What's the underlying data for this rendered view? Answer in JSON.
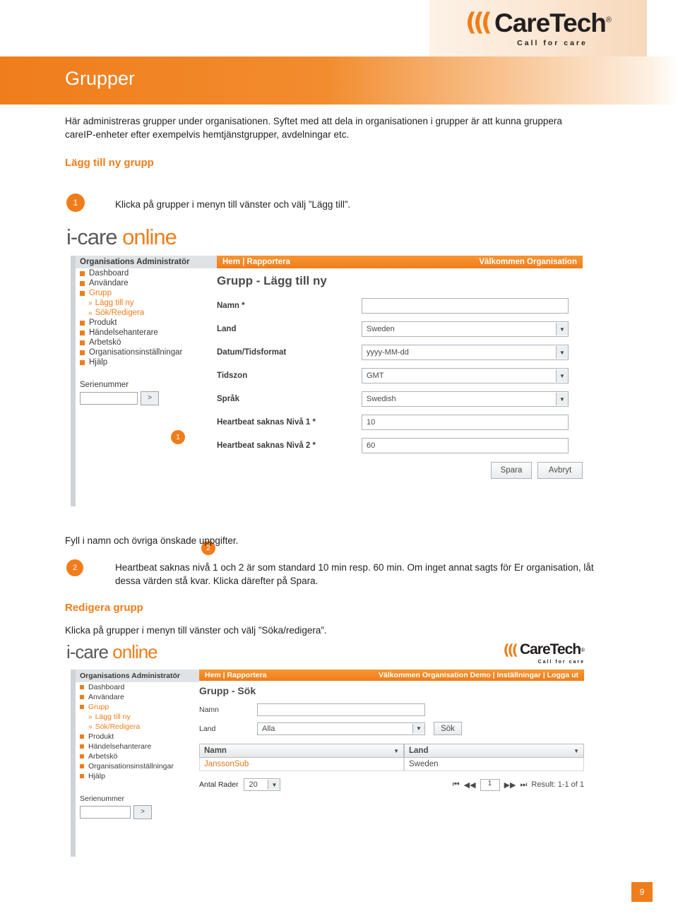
{
  "brand": {
    "chevrons": "(((",
    "name": "CareTech",
    "registered": "®",
    "tagline": "Call for care"
  },
  "page": {
    "title": "Grupper",
    "footer_page_number": "9"
  },
  "intro": "Här administreras grupper under organisationen. Syftet med att dela in organisationen i grupper är att kunna gruppera careIP-enheter efter exempelvis hemtjänstgrupper, avdelningar etc.",
  "sections": {
    "add_group_heading": "Lägg till ny grupp",
    "edit_group_heading": "Redigera grupp"
  },
  "steps": {
    "step1_number": "1",
    "step1_text": "Klicka på grupper i menyn till vänster och välj ”Lägg till”.",
    "after_shot1_text": "Fyll i namn och övriga önskade uppgifter.",
    "step2_number": "2",
    "step2_text": "Heartbeat saknas nivå 1 och 2 är som standard 10 min resp. 60 min. Om inget annat sagts för Er organisation, låt dessa värden stå kvar. Klicka därefter på Spara.",
    "edit_text": "Klicka på grupper i menyn till vänster och välj ”Söka/redigera”."
  },
  "screenshot1": {
    "logo_i": "i-care ",
    "logo_o": "online",
    "sidebar": {
      "header": "Organisations Administratör",
      "items": [
        {
          "label": "Dashboard",
          "type": "top"
        },
        {
          "label": "Användare",
          "type": "top"
        },
        {
          "label": "Grupp",
          "type": "top",
          "active": true
        },
        {
          "label": "Lägg till ny",
          "type": "sub"
        },
        {
          "label": "Sök/Redigera",
          "type": "sub"
        },
        {
          "label": "Produkt",
          "type": "top"
        },
        {
          "label": "Händelsehanterare",
          "type": "top"
        },
        {
          "label": "Arbetskö",
          "type": "top"
        },
        {
          "label": "Organisationsinställningar",
          "type": "top"
        },
        {
          "label": "Hjälp",
          "type": "top"
        }
      ],
      "serial_label": "Serienummer",
      "serial_value": "",
      "serial_button": ">"
    },
    "topnav_left": "Hem | Rapportera",
    "topnav_right": "Välkommen Organisation",
    "page_title": "Grupp - Lägg till ny",
    "form": [
      {
        "label": "Namn *",
        "value": "",
        "control": "input"
      },
      {
        "label": "Land",
        "value": "Sweden",
        "control": "select"
      },
      {
        "label": "Datum/Tidsformat",
        "value": "yyyy-MM-dd",
        "control": "select"
      },
      {
        "label": "Tidszon",
        "value": "GMT",
        "control": "select"
      },
      {
        "label": "Språk",
        "value": "Swedish",
        "control": "select"
      },
      {
        "label": "Heartbeat saknas Nivå 1 *",
        "value": "10",
        "control": "input"
      },
      {
        "label": "Heartbeat saknas Nivå 2 *",
        "value": "60",
        "control": "input"
      }
    ],
    "save_button": "Spara",
    "cancel_button": "Avbryt",
    "callout1": "1",
    "callout2": "2"
  },
  "screenshot2": {
    "logo_i": "i-care ",
    "logo_o": "online",
    "brand_chevrons": "(((",
    "brand_name": "CareTech",
    "brand_reg": "®",
    "brand_tagline": "Call for care",
    "sidebar": {
      "header": "Organisations Administratör",
      "items": [
        {
          "label": "Dashboard",
          "type": "top"
        },
        {
          "label": "Användare",
          "type": "top"
        },
        {
          "label": "Grupp",
          "type": "top",
          "active": true
        },
        {
          "label": "Lägg till ny",
          "type": "sub"
        },
        {
          "label": "Sök/Redigera",
          "type": "sub"
        },
        {
          "label": "Produkt",
          "type": "top"
        },
        {
          "label": "Händelsehanterare",
          "type": "top"
        },
        {
          "label": "Arbetskö",
          "type": "top"
        },
        {
          "label": "Organisationsinställningar",
          "type": "top"
        },
        {
          "label": "Hjälp",
          "type": "top"
        }
      ],
      "serial_label": "Serienummer",
      "serial_value": "",
      "serial_button": ">"
    },
    "topnav_left": "Hem | Rapportera",
    "topnav_right": "Välkommen Organisation Demo | Inställningar | Logga ut",
    "page_title": "Grupp - Sök",
    "namn_label": "Namn",
    "namn_value": "",
    "land_label": "Land",
    "land_value": "Alla",
    "search_button": "Sök",
    "grid": {
      "columns": [
        "Namn",
        "Land"
      ],
      "rows": [
        [
          "JanssonSub",
          "Sweden"
        ]
      ]
    },
    "rows_label": "Antal Rader",
    "rows_value": "20",
    "page_value": "1",
    "result_text": "Result: 1-1 of 1"
  }
}
